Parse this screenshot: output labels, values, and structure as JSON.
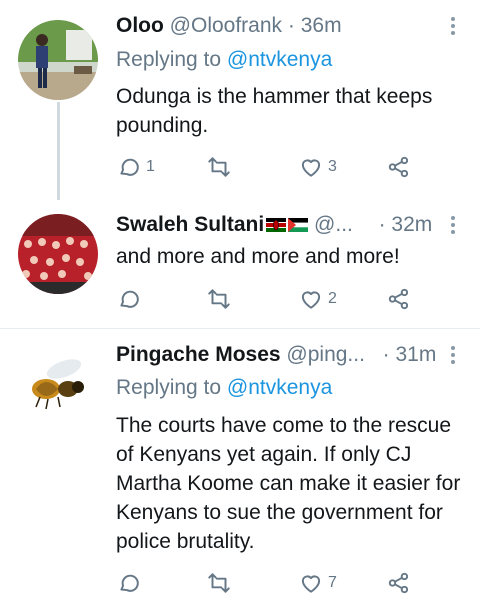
{
  "tweets": [
    {
      "name": "Oloo",
      "handle": "@Oloofrank",
      "separator": "·",
      "time": "36m",
      "reply_prefix": "Replying to",
      "reply_to": "@ntvkenya",
      "text": "Odunga is the hammer that keeps pounding.",
      "replies": "1",
      "retweets": "",
      "likes": "3",
      "avatar": "man-presenting-avatar"
    },
    {
      "name": "Swaleh Sultani",
      "handle": "@...",
      "separator": "·",
      "time": "32m",
      "text": "and more and more and more!",
      "replies": "",
      "retweets": "",
      "likes": "2",
      "avatar": "stadium-crowd-avatar",
      "flags": [
        "kenya-flag-icon",
        "palestine-flag-icon"
      ]
    },
    {
      "name": "Pingache Moses",
      "handle": "@ping...",
      "separator": "·",
      "time": "31m",
      "reply_prefix": "Replying to",
      "reply_to": "@ntvkenya",
      "text": "The courts have come to the rescue of Kenyans yet again. If only CJ Martha Koome can make it easier for Kenyans to sue the government for police brutality.",
      "replies": "",
      "retweets": "",
      "likes": "7",
      "avatar": "bee-avatar"
    }
  ],
  "colors": {
    "link": "#1b95e0",
    "muted": "#657786",
    "divider": "#e6ecf0"
  }
}
